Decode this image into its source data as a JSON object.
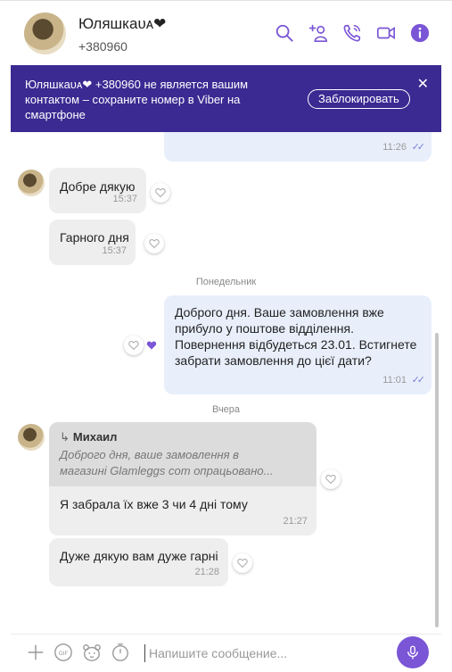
{
  "header": {
    "contact_name": "Юляшкаυᴀ❤",
    "contact_phone": "+380960"
  },
  "banner": {
    "text_line1": "Юляшкаυᴀ❤ +380960               не является вашим",
    "text_line2": "контактом – сохраните номер в Viber на",
    "text_line3": "смартфоне",
    "block_label": "Заблокировать",
    "close_glyph": "✕"
  },
  "messages": {
    "m0_time": "11:26",
    "m1_text": "Добре дякую",
    "m1_time": "15:37",
    "m2_text": "Гарного дня",
    "m2_time": "15:37",
    "day1": "Понедельник",
    "m3_line1": "Доброго дня. Ваше замовлення вже",
    "m3_line2": "прибуло у поштове відділення.",
    "m3_line3": "Повернення відбудеться 23.01. Встигнете",
    "m3_line4": "забрати замовлення до цієї дати?",
    "m3_time": "11:01",
    "day2": "Вчера",
    "m4_reply_name": "Михаил",
    "m4_reply_line1": "Доброго дня, ваше замовлення в",
    "m4_reply_line2": "магазині Glamleggs com опрацьовано...",
    "m4_text": "Я забрала їх вже 3 чи 4 дні тому",
    "m4_time": "21:27",
    "m5_text": "Дуже дякую вам дуже гарні",
    "m5_time": "21:28",
    "check_glyph": "✓✓"
  },
  "input": {
    "placeholder": "Напишите сообщение..."
  },
  "colors": {
    "accent": "#7a55d6",
    "banner_bg": "#3a2a92",
    "incoming_bubble": "#eeeeee",
    "outgoing_bubble": "#e8effb"
  }
}
